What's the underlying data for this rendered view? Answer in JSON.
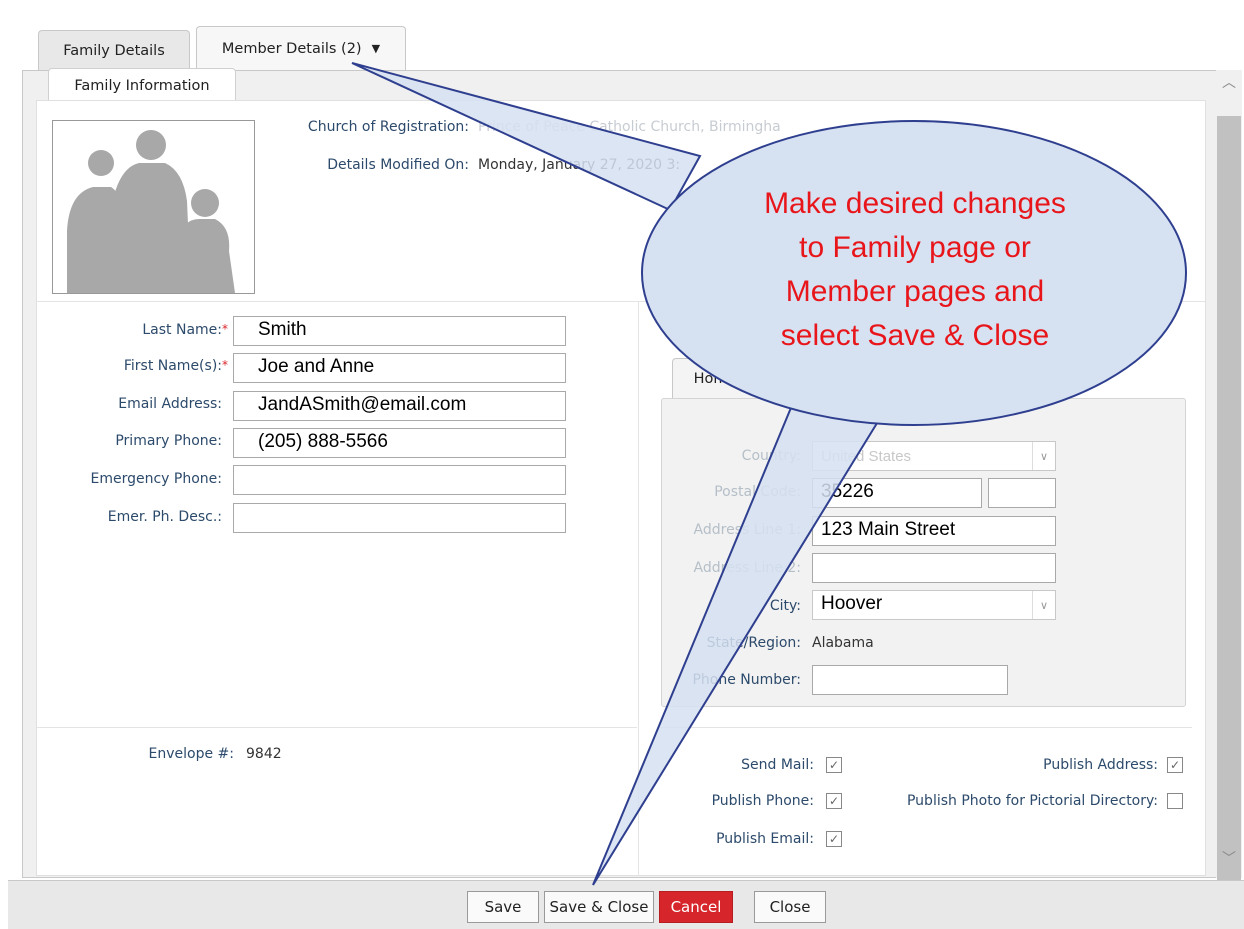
{
  "tabs": {
    "family_details": "Family Details",
    "member_details": "Member Details (2)",
    "dropdown_arrow": "▼",
    "family_information": "Family Information"
  },
  "info": {
    "church_label": "Church of Registration:",
    "church_value": "Prince of Peace Catholic Church, Birmingha",
    "modified_label": "Details Modified On:",
    "modified_value": "Monday, January 27, 2020 3:"
  },
  "form": {
    "last_name_label": "Last Name:",
    "last_name_value": "Smith",
    "first_name_label": "First Name(s):",
    "first_name_value": "Joe and Anne",
    "email_label": "Email Address:",
    "email_value": "JandASmith@email.com",
    "primary_phone_label": "Primary Phone:",
    "primary_phone_value": "(205) 888-5566",
    "emergency_phone_label": "Emergency Phone:",
    "emergency_phone_value": "",
    "emer_desc_label": "Emer. Ph. Desc.:",
    "emer_desc_value": "",
    "required_mark": "*"
  },
  "envelope": {
    "label": "Envelope #:",
    "value": "9842"
  },
  "address": {
    "tab_home": "Home",
    "country_label": "Country:",
    "country_value": "United States",
    "postal_label": "Postal Code:",
    "postal_value": "35226",
    "postal_ext_value": "",
    "line1_label": "Address Line 1:",
    "line1_value": "123 Main Street",
    "line2_label": "Address Line 2:",
    "line2_value": "",
    "city_label": "City:",
    "city_value": "Hoover",
    "state_label": "State/Region:",
    "state_value": "Alabama",
    "phone_label": "Phone Number:",
    "phone_value": ""
  },
  "options": {
    "send_mail": "Send Mail:",
    "publish_phone": "Publish Phone:",
    "publish_email": "Publish Email:",
    "publish_address": "Publish Address:",
    "publish_photo": "Publish Photo for Pictorial Directory:",
    "check": "✓"
  },
  "buttons": {
    "save": "Save",
    "save_close": "Save & Close",
    "cancel": "Cancel",
    "close": "Close"
  },
  "callout": {
    "line1": "Make desired changes",
    "line2": "to Family page or",
    "line3": "Member pages and",
    "line4": "select Save & Close"
  },
  "scroll": {
    "up": "︿",
    "down": "﹀"
  },
  "colors": {
    "accent_label": "#2c4a6b",
    "callout_fill": "#d6e1f1",
    "callout_stroke": "#2f3f8f",
    "callout_text": "#e8161b",
    "cancel_bg": "#d6262b"
  }
}
